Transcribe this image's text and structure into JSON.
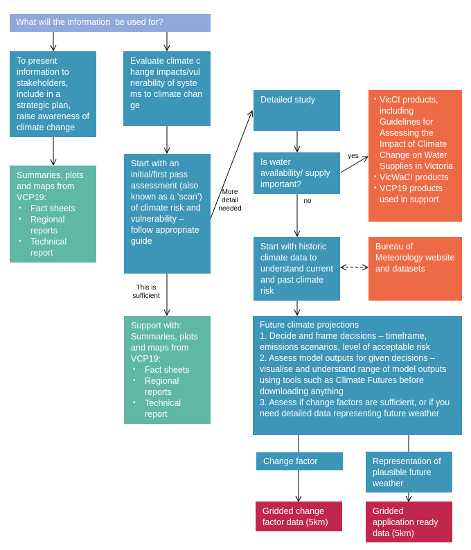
{
  "diagram": {
    "type": "flowchart",
    "colors": {
      "question": "#8EA9DB",
      "process": "#3D95B8",
      "product_vcp19": "#5FB8A5",
      "external_products": "#EE6A45",
      "data_products": "#C1274B"
    },
    "nodes": {
      "question": {
        "text": "What will the information  be used for?"
      },
      "present": {
        "text": "To present information to stakeholders, include in a strategic plan, raise awareness of climate change"
      },
      "evaluate": {
        "text": "Evaluate climate change impacts/vulnerability of systems to climate change"
      },
      "summaries": {
        "intro": "Summaries, plots and maps from VCP19:",
        "items": [
          "Fact sheets",
          "Regional reports",
          "Technical report"
        ]
      },
      "initial": {
        "text": "Start with an initial/first pass assessment (also known as a ‘scan’) of climate risk and vulnerability – follow appropriate guide"
      },
      "support": {
        "intro": "Support with: Summaries, plots and maps from VCP19:",
        "items": [
          "Fact sheets",
          "Regional reports",
          "Technical report"
        ]
      },
      "detailed": {
        "text": "Detailed study"
      },
      "water": {
        "text": "Is water availability/ supply important?"
      },
      "viccl": {
        "items": [
          "VicCI products, including Guidelines for Assessing the Impact of Climate Change on Water Supplies in Victoria",
          "VicWaCI products",
          "VCP19 products used in support"
        ]
      },
      "historic": {
        "text": "Start with historic climate data to understand current and past climate risk"
      },
      "bom": {
        "text": "Bureau of Meteorology website and datasets"
      },
      "future": {
        "title": "Future climate projections",
        "steps": [
          "1. Decide and frame decisions – timeframe, emissions scenarios, level of acceptable risk",
          "2. Assess model outputs for given decisions – visualise and understand range of model outputs using tools such as Climate Futures before downloading anything",
          "3. Assess if change factors are sufficient, or if you need detailed data representing future weather"
        ]
      },
      "change_factor": {
        "text": "Change factor"
      },
      "representation": {
        "text": "Representation of plausible future weather"
      },
      "gridded_change": {
        "text": "Gridded change factor data (5km)"
      },
      "gridded_app": {
        "text": "Gridded application ready data (5km)"
      }
    },
    "edge_labels": {
      "more_detail": "More detail needed",
      "sufficient": "This is sufficient",
      "yes": "yes",
      "no": "no"
    }
  }
}
